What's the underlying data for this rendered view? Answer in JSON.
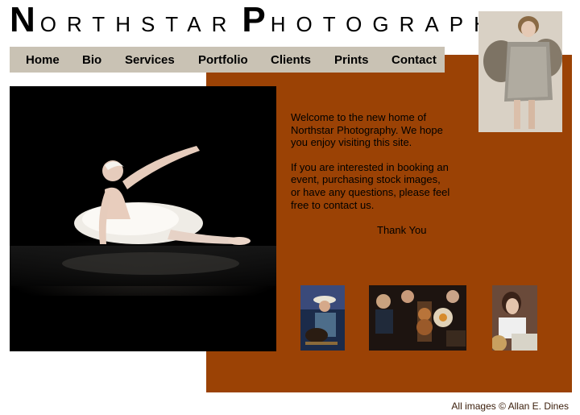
{
  "site": {
    "title_word1_cap": "N",
    "title_word1_rest": "ORTHSTAR",
    "title_word2_cap": "P",
    "title_word2_rest": "HOTOGRAPHY"
  },
  "nav": {
    "items": [
      {
        "label": "Home"
      },
      {
        "label": "Bio"
      },
      {
        "label": "Services"
      },
      {
        "label": "Portfolio"
      },
      {
        "label": "Clients"
      },
      {
        "label": "Prints"
      },
      {
        "label": "Contact"
      }
    ]
  },
  "content": {
    "welcome_p1": "Welcome to the new home of Northstar Photography. We hope you enjoy visiting this site.",
    "welcome_p2": "If you are interested in booking an event, purchasing stock images, or have any questions, please feel free to contact us.",
    "thanks": "Thank You"
  },
  "footer": {
    "credit": "All images © Allan E. Dines"
  },
  "colors": {
    "accent_panel": "#9b4205",
    "nav_bar": "#c9c2b4"
  }
}
